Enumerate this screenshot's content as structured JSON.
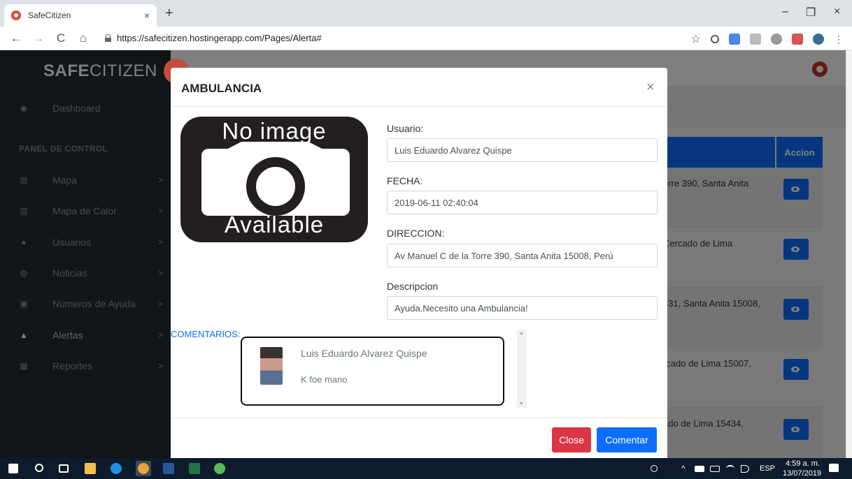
{
  "browser": {
    "tab_title": "SafeCitizen",
    "tab_close": "×",
    "new_tab": "+",
    "back": "←",
    "forward": "→",
    "reload": "C",
    "home": "⌂",
    "url": "https://safecitizen.hostingerapp.com/Pages/Alerta#",
    "minimize": "–",
    "restore": "❐",
    "close": "×",
    "star": "☆"
  },
  "sidebar": {
    "brand_bold": "SAFE",
    "brand_rest": "CITIZEN",
    "dashboard": {
      "icon": "dashboard-icon",
      "label": "Dashboard"
    },
    "section_header": "PANEL DE CONTROL",
    "items": [
      {
        "icon": "map-icon",
        "label": "Mapa",
        "arrow": ">"
      },
      {
        "icon": "map-icon",
        "label": "Mapa de Calor",
        "arrow": ">"
      },
      {
        "icon": "user-icon",
        "label": "Usuarios",
        "arrow": ">"
      },
      {
        "icon": "globe-icon",
        "label": "Noticias",
        "arrow": ">"
      },
      {
        "icon": "phone-icon",
        "label": "Numeros de Ayuda",
        "arrow": ">"
      },
      {
        "icon": "warning-icon",
        "label": "Alertas",
        "arrow": ">"
      },
      {
        "icon": "bar-chart-icon",
        "label": "Reportes",
        "arrow": ">"
      }
    ]
  },
  "table": {
    "action_header": "Accion",
    "rows": [
      "orre 390, Santa Anita",
      "Cercado de Lima",
      "331, Santa Anita 15008,",
      "rcado de Lima 15007,",
      "ado de Lima 15434,"
    ]
  },
  "modal": {
    "title": "AMBULANCIA",
    "close_x": "×",
    "image_top_text": "No image",
    "image_bottom_text": "Available",
    "usuario_label": "Usuario:",
    "usuario_value": "Luis Eduardo Alvarez Quispe",
    "fecha_label": "FECHA:",
    "fecha_value": "2019-06-11 02:40:04",
    "direccion_label": "DIRECCION:",
    "direccion_value": "Av Manuel C de la Torre 390, Santa Anita 15008, Perú",
    "descripcion_label": "Descripcion",
    "descripcion_value": "Ayuda.Necesito una Ambulancia!",
    "comentarios_label": "COMENTARIOS:",
    "comment": {
      "author": "Luis Eduardo Alvarez Quispe",
      "text": "K foe mano"
    },
    "close_button": "Close",
    "comentar_button": "Comentar"
  },
  "taskbar": {
    "lang": "ESP",
    "time": "4:59 a. m.",
    "date": "13/07/2019"
  },
  "colors": {
    "sidebar_bg": "#222d32",
    "primary": "#0d6efd",
    "danger": "#dc3545",
    "taskbar": "#0e1b2c"
  }
}
